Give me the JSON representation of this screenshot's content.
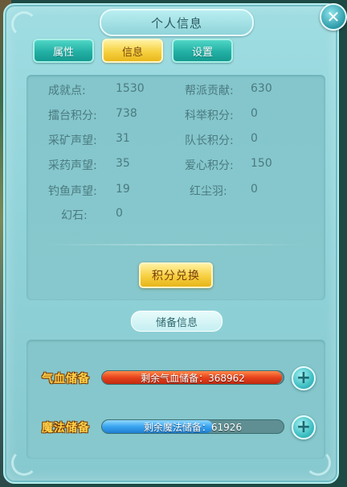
{
  "window": {
    "title": "个人信息",
    "close_icon": "✕"
  },
  "tabs": [
    {
      "label": "属性",
      "active": false
    },
    {
      "label": "信息",
      "active": true
    },
    {
      "label": "设置",
      "active": false
    }
  ],
  "stats": {
    "left": [
      {
        "label": "成就点:",
        "value": "1530"
      },
      {
        "label": "擂台积分:",
        "value": "738"
      },
      {
        "label": "采矿声望:",
        "value": "31"
      },
      {
        "label": "采药声望:",
        "value": "35"
      },
      {
        "label": "钓鱼声望:",
        "value": "19"
      },
      {
        "label": "幻石:",
        "value": "0"
      }
    ],
    "right": [
      {
        "label": "帮派贡献:",
        "value": "630"
      },
      {
        "label": "科举积分:",
        "value": "0"
      },
      {
        "label": "队长积分:",
        "value": "0"
      },
      {
        "label": "爱心积分:",
        "value": "150"
      },
      {
        "label": "红尘羽:",
        "value": "0"
      }
    ]
  },
  "exchange_button": "积分兑换",
  "reserve_section": {
    "title": "储备信息",
    "hp": {
      "label": "气血储备",
      "bar_text": "剩余气血储备：368962",
      "fill": 0.99,
      "plus": "+"
    },
    "mp": {
      "label": "魔法储备",
      "bar_text": "剩余魔法储备：61926",
      "fill": 0.61,
      "plus": "+"
    }
  },
  "colors": {
    "panel": "#8fd2d8",
    "tab_teal": "#23b0a4",
    "tab_active": "#f6d040",
    "hp_bar": "#e8431c",
    "mp_bar": "#3aa4f0"
  }
}
